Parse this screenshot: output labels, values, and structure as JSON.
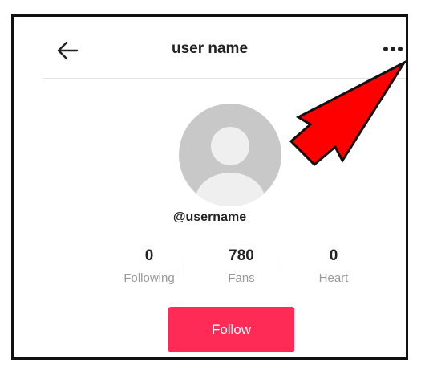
{
  "header": {
    "title": "user name",
    "back_icon": "arrow-left-icon",
    "more_icon": "more-horizontal-icon"
  },
  "profile": {
    "avatar_icon": "default-avatar-icon",
    "username": "@username"
  },
  "stats": [
    {
      "value": "0",
      "label": "Following"
    },
    {
      "value": "780",
      "label": "Fans"
    },
    {
      "value": "0",
      "label": "Heart"
    }
  ],
  "actions": {
    "follow_label": "Follow"
  },
  "annotation": {
    "icon": "red-pointer-arrow-icon",
    "color": "#ff0000"
  },
  "colors": {
    "follow_button": "#fd2b55",
    "avatar_bg": "#c8c8c8"
  }
}
